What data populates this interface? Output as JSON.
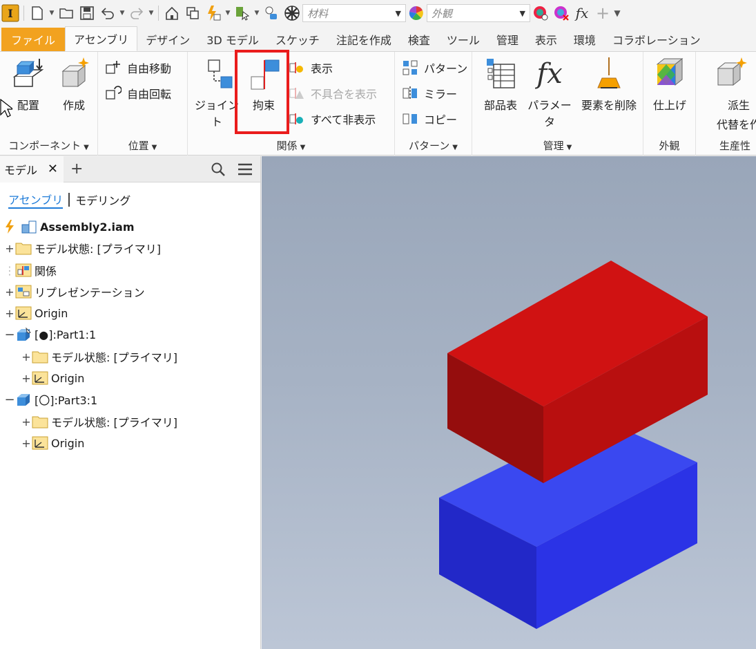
{
  "qat": {
    "material_placeholder": "材料",
    "appearance_placeholder": "外観",
    "fx": "fx"
  },
  "tabs": [
    "ファイル",
    "アセンブリ",
    "デザイン",
    "3D モデル",
    "スケッチ",
    "注記を作成",
    "検査",
    "ツール",
    "管理",
    "表示",
    "環境",
    "コラボレーション"
  ],
  "ribbon": {
    "component": {
      "title": "コンポーネント",
      "place": "配置",
      "create": "作成"
    },
    "position": {
      "title": "位置",
      "free_move": "自由移動",
      "free_rotate": "自由回転"
    },
    "relationships": {
      "title": "関係",
      "joint": "ジョイント",
      "constrain": "拘束",
      "show": "表示",
      "show_sick": "不具合を表示",
      "hide_all": "すべて非表示"
    },
    "pattern": {
      "title": "パターン",
      "pattern": "パターン",
      "mirror": "ミラー",
      "copy": "コピー"
    },
    "manage": {
      "title": "管理",
      "bom": "部品表",
      "parameters": "パラメータ",
      "delete_face": "要素を削除",
      "fx": "fx"
    },
    "appearance": {
      "title": "外観",
      "finish": "仕上げ"
    },
    "productivity": {
      "title": "生産性",
      "derive_line1": "派生",
      "derive_line2": "代替を作"
    }
  },
  "browser": {
    "tab_label": "モデル",
    "view_assembly": "アセンブリ",
    "view_modeling": "モデリング",
    "tree": {
      "root": "Assembly2.iam",
      "model_states": "モデル状態: [プライマリ]",
      "relationships": "関係",
      "representations": "リプレゼンテーション",
      "origin": "Origin",
      "part1": "[●]:Part1:1",
      "part1_model_states": "モデル状態: [プライマリ]",
      "part1_origin": "Origin",
      "part3": "[〇]:Part3:1",
      "part3_model_states": "モデル状態: [プライマリ]",
      "part3_origin": "Origin"
    }
  },
  "colors": {
    "file_tab": "#f2a21f",
    "highlight": "#ea1c1c",
    "red_box": "#cc1111",
    "blue_box": "#2a2ee0",
    "viewport_bg": "#a6b2c4"
  }
}
